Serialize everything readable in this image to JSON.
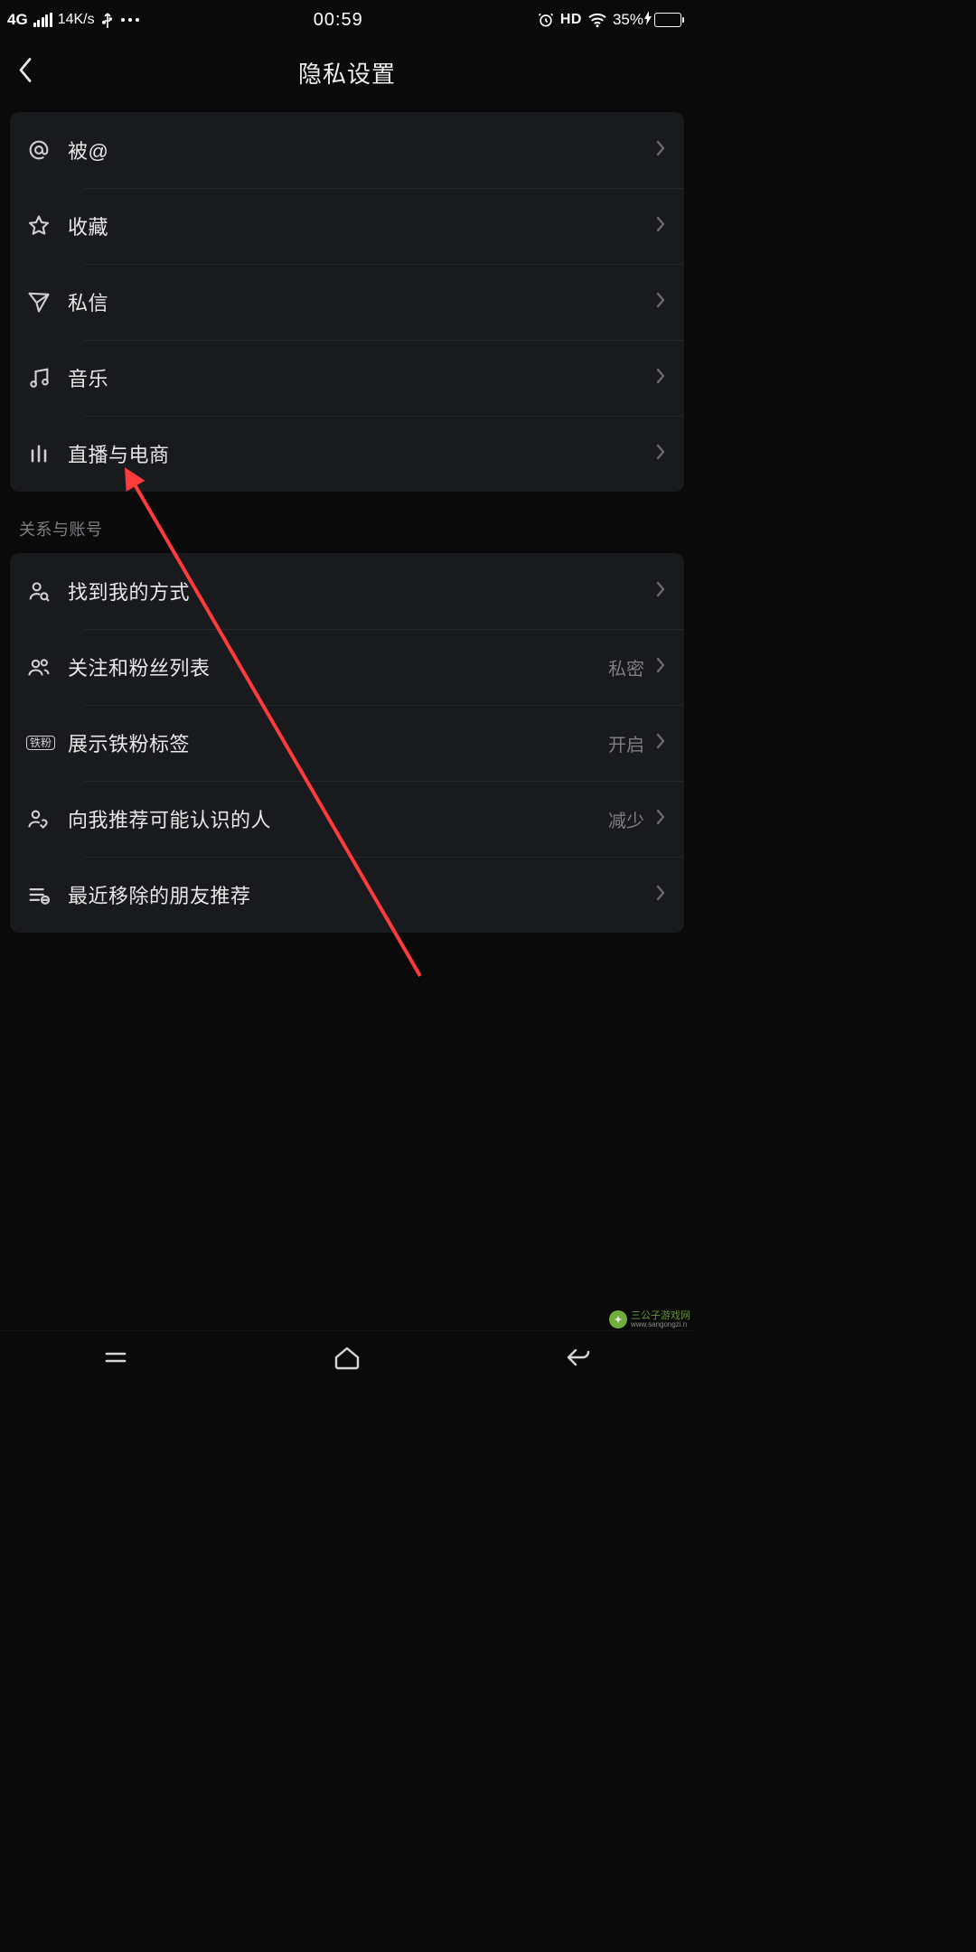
{
  "status_bar": {
    "network": "4G",
    "speed": "14K/s",
    "time": "00:59",
    "hd": "HD",
    "battery_pct": "35%"
  },
  "header": {
    "title": "隐私设置"
  },
  "group1": {
    "items": [
      {
        "label": "被@"
      },
      {
        "label": "收藏"
      },
      {
        "label": "私信"
      },
      {
        "label": "音乐"
      },
      {
        "label": "直播与电商"
      }
    ]
  },
  "section2_title": "关系与账号",
  "group2": {
    "items": [
      {
        "label": "找到我的方式",
        "value": ""
      },
      {
        "label": "关注和粉丝列表",
        "value": "私密"
      },
      {
        "label": "展示铁粉标签",
        "value": "开启"
      },
      {
        "label": "向我推荐可能认识的人",
        "value": "减少"
      },
      {
        "label": "最近移除的朋友推荐",
        "value": ""
      }
    ]
  },
  "tiefen_badge": "铁粉",
  "watermark": {
    "brand": "三公子游戏网",
    "url": "www.sangongzi.n"
  }
}
